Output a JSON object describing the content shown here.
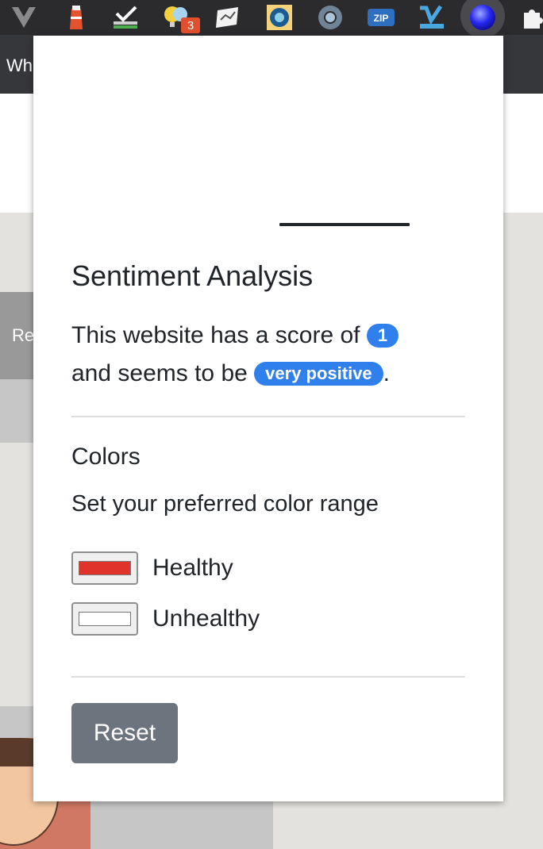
{
  "toolbar": {
    "badge_count": "3",
    "zip_label": "ZIP",
    "icons": [
      "vue-devtools-icon",
      "lighthouse-icon",
      "checkmark-icon",
      "lightbulb-icon",
      "note-icon",
      "extension-blue-icon",
      "circle-arrow-icon",
      "zip-icon",
      "vimeo-icon",
      "sentiment-orb-icon",
      "puzzle-icon"
    ]
  },
  "page": {
    "bar_text": "Wh",
    "tab_text": "Re"
  },
  "popup": {
    "heading": "Sentiment Analysis",
    "score_text_1": "This website has a score of",
    "score_value": "1",
    "score_text_2": "and seems to be",
    "sentiment_label": "very positive",
    "score_text_end": ".",
    "colors_heading": "Colors",
    "colors_desc": "Set your preferred color range",
    "healthy_label": "Healthy",
    "healthy_color": "#e0332b",
    "unhealthy_label": "Unhealthy",
    "unhealthy_color": "#ffffff",
    "reset_label": "Reset"
  }
}
